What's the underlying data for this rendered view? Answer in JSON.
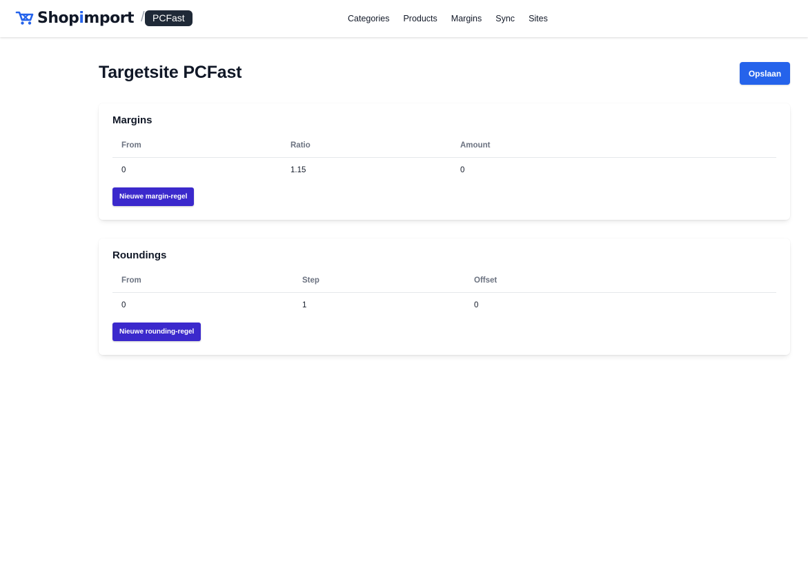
{
  "header": {
    "brand_prefix": "Shop",
    "brand_highlight": "i",
    "brand_suffix": "mport",
    "brand_icon": "shopping-cart-icon",
    "site_badge": "PCFast",
    "nav": [
      {
        "label": "Categories"
      },
      {
        "label": "Products"
      },
      {
        "label": "Margins"
      },
      {
        "label": "Sync"
      },
      {
        "label": "Sites"
      }
    ]
  },
  "page": {
    "title": "Targetsite PCFast",
    "save_label": "Opslaan"
  },
  "margins": {
    "title": "Margins",
    "columns": [
      "From",
      "Ratio",
      "Amount"
    ],
    "rows": [
      [
        "0",
        "1.15",
        "0"
      ]
    ],
    "add_label": "Nieuwe margin-regel"
  },
  "roundings": {
    "title": "Roundings",
    "columns": [
      "From",
      "Step",
      "Offset"
    ],
    "rows": [
      [
        "0",
        "1",
        "0"
      ]
    ],
    "add_label": "Nieuwe rounding-regel"
  },
  "colors": {
    "brand_accent": "#2563eb",
    "primary_button": "#2563eb",
    "add_button": "#3b29cc",
    "badge_bg": "#1f2937"
  }
}
